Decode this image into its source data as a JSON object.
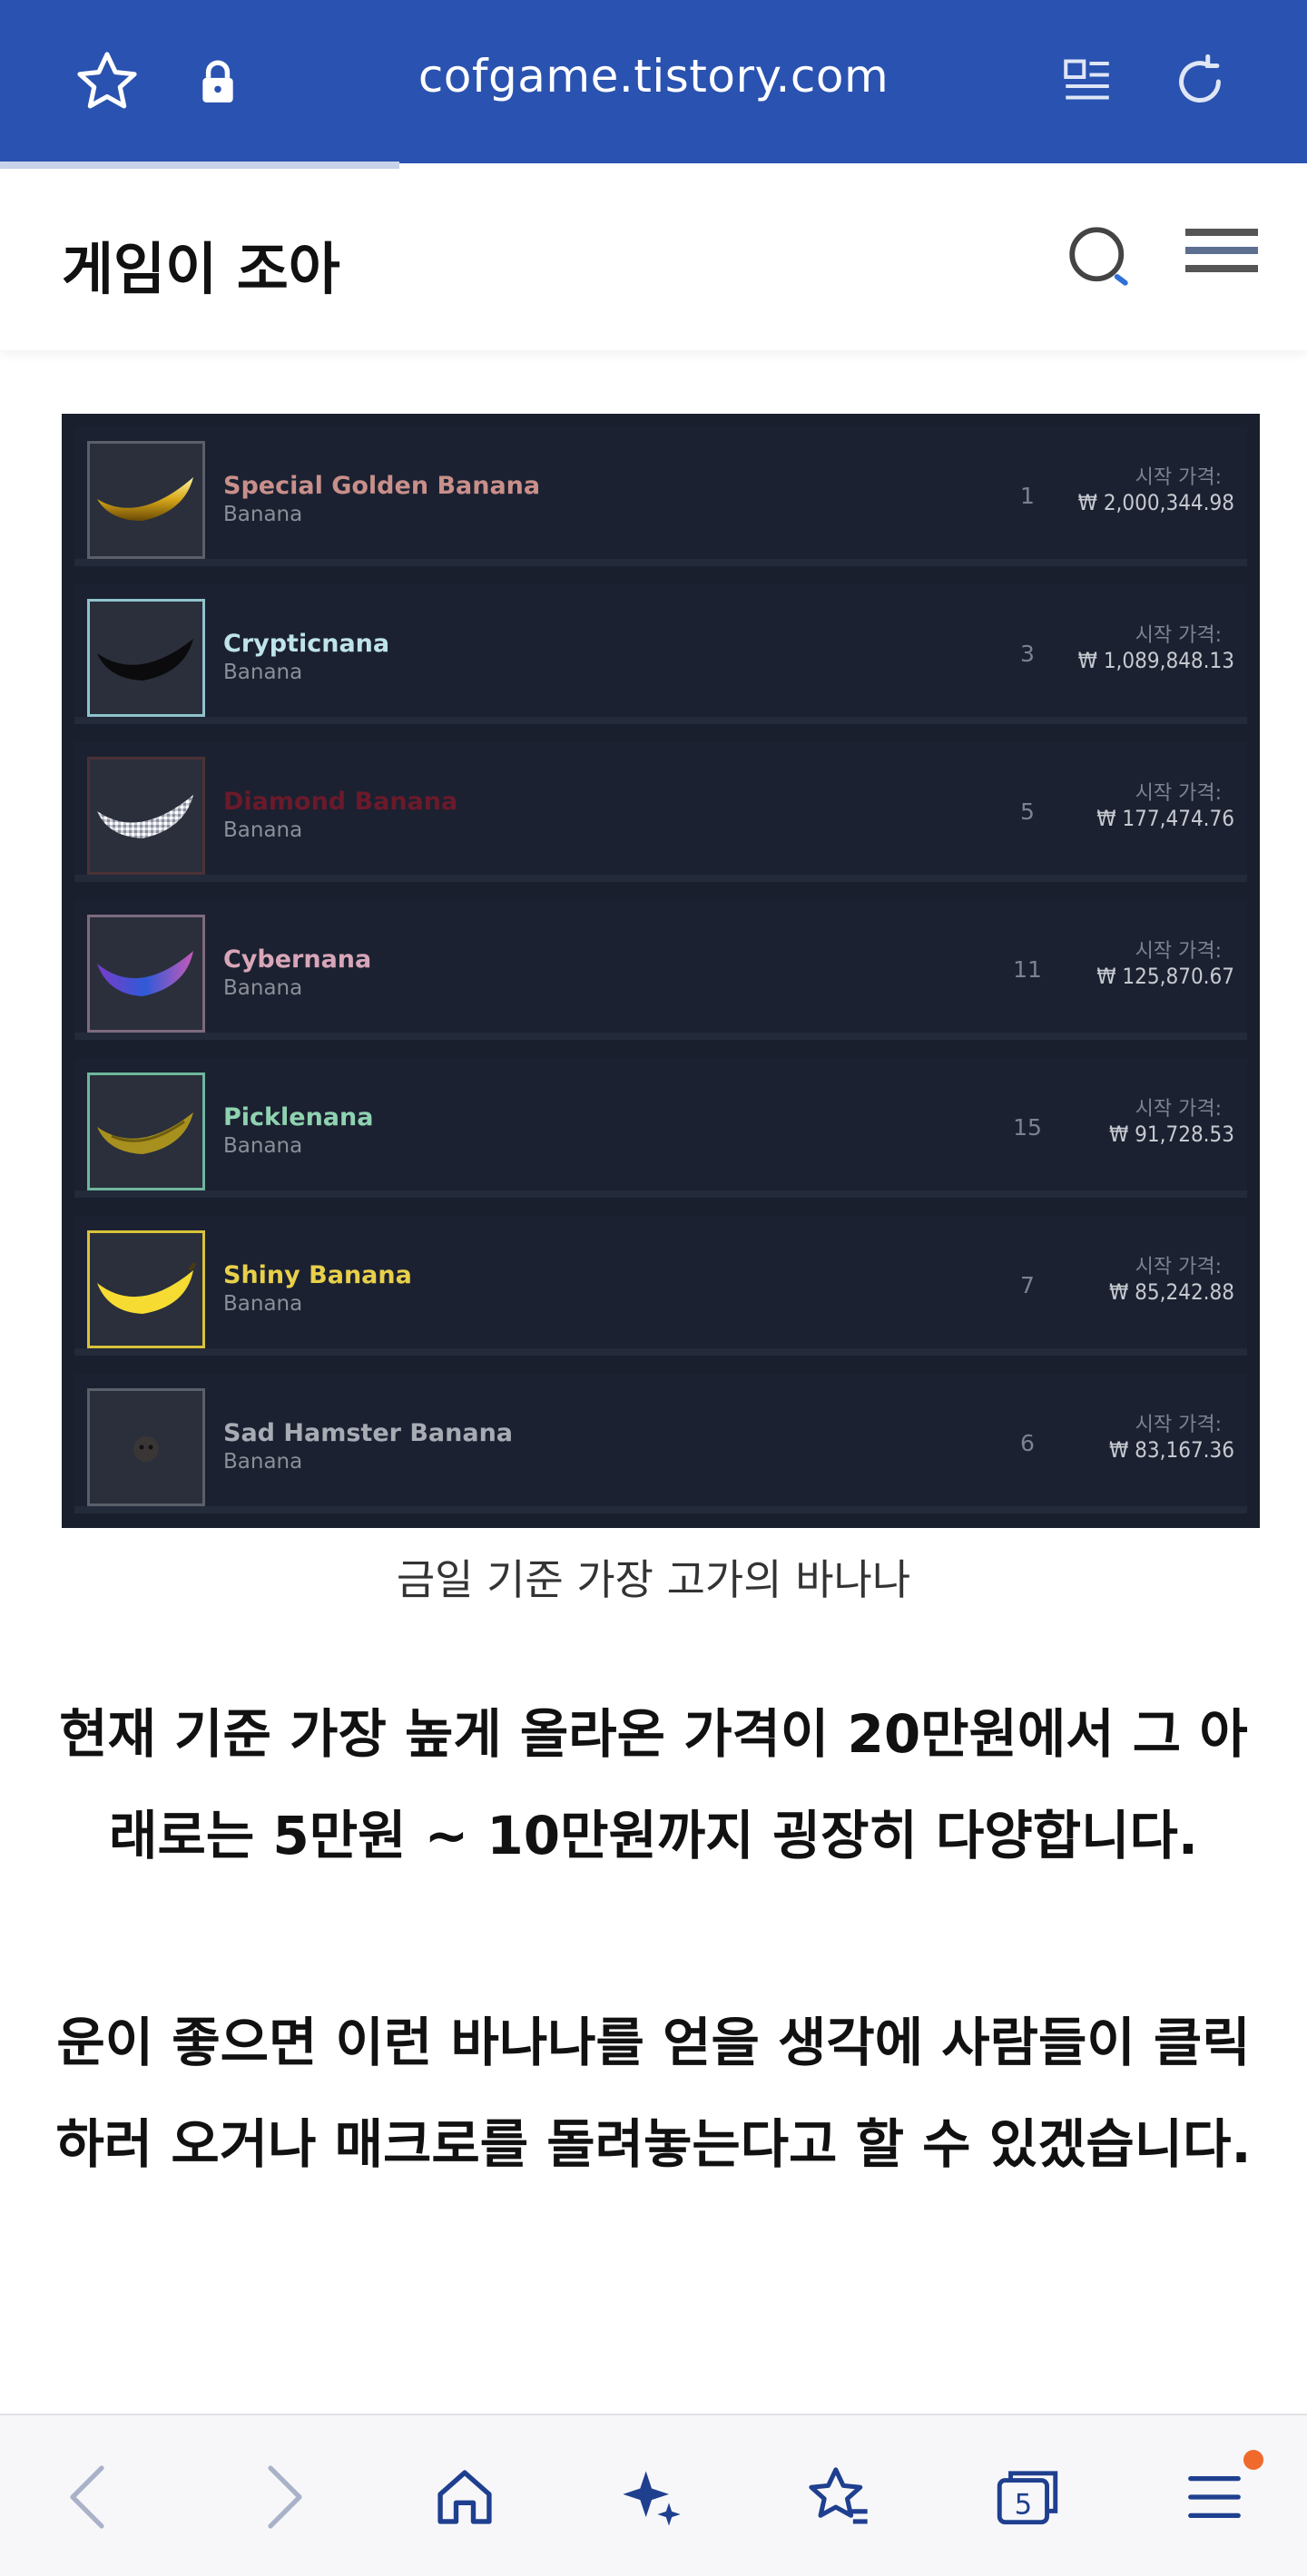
{
  "browser": {
    "url": "cofgame.tistory.com",
    "accent_color": "#2a52b0",
    "icons": [
      "star-outline-icon",
      "lock-icon",
      "reader-mode-icon",
      "reload-icon"
    ]
  },
  "blog": {
    "title": "게임이 조아",
    "icons": [
      "search-icon",
      "hamburger-menu-icon"
    ]
  },
  "item_list": {
    "price_label": "시작 가격:",
    "items": [
      {
        "name": "Special Golden Banana",
        "type": "Banana",
        "qty": "1",
        "price": "₩ 2,000,344.98",
        "name_color": "#c98f8a",
        "thumb": "golden-banana-icon"
      },
      {
        "name": "Crypticnana",
        "type": "Banana",
        "qty": "3",
        "price": "₩ 1,089,848.13",
        "name_color": "#bfe3ea",
        "thumb": "black-banana-icon"
      },
      {
        "name": "Diamond Banana",
        "type": "Banana",
        "qty": "5",
        "price": "₩ 177,474.76",
        "name_color": "#6a1a2a",
        "thumb": "diamond-banana-icon"
      },
      {
        "name": "Cybernana",
        "type": "Banana",
        "qty": "11",
        "price": "₩ 125,870.67",
        "name_color": "#d8a6b8",
        "thumb": "cyber-banana-icon"
      },
      {
        "name": "Picklenana",
        "type": "Banana",
        "qty": "15",
        "price": "₩ 91,728.53",
        "name_color": "#8fd2b0",
        "thumb": "pickle-banana-icon"
      },
      {
        "name": "Shiny Banana",
        "type": "Banana",
        "qty": "7",
        "price": "₩ 85,242.88",
        "name_color": "#e8d04a",
        "thumb": "shiny-banana-icon"
      },
      {
        "name": "Sad Hamster Banana",
        "type": "Banana",
        "qty": "6",
        "price": "₩ 83,167.36",
        "name_color": "#a7abb3",
        "thumb": "hamster-banana-icon"
      }
    ]
  },
  "caption": "금일 기준 가장 고가의 바나나",
  "paragraphs": [
    "현재 기준 가장 높게 올라온 가격이 20만원에서 그 아래로는 5만원 ~ 10만원까지 굉장히 다양합니다.",
    "운이 좋으면 이런 바나나를 얻을 생각에 사람들이 클릭하러 오거나 매크로를 돌려놓는다고 할 수 있겠습니다."
  ],
  "toolbar": {
    "tab_count": "5",
    "icons": [
      "back-icon",
      "forward-icon",
      "home-icon",
      "ai-sparkle-icon",
      "bookmarks-icon",
      "tabs-icon",
      "menu-icon"
    ]
  }
}
